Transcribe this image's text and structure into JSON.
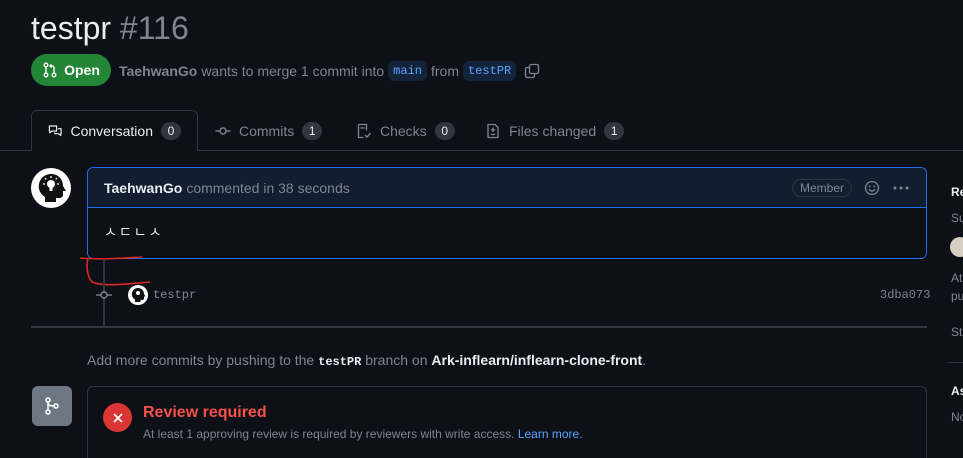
{
  "pr": {
    "title": "testpr",
    "number": "#116",
    "state": "Open",
    "author": "TaehwanGo",
    "merge_text": "wants to merge 1 commit into",
    "base_branch": "main",
    "from_text": "from",
    "head_branch": "testPR"
  },
  "tabs": [
    {
      "label": "Conversation",
      "count": "0",
      "icon": "comment-discussion-icon"
    },
    {
      "label": "Commits",
      "count": "1",
      "icon": "git-commit-icon"
    },
    {
      "label": "Checks",
      "count": "0",
      "icon": "checklist-icon"
    },
    {
      "label": "Files changed",
      "count": "1",
      "icon": "file-diff-icon"
    }
  ],
  "comment": {
    "author": "TaehwanGo",
    "meta": "commented in 38 seconds",
    "badge": "Member",
    "body": "ㅅㄷㄴㅅ"
  },
  "commit": {
    "message": "testpr",
    "sha": "3dba073"
  },
  "more_commits": {
    "prefix": "Add more commits by pushing to the",
    "branch": "testPR",
    "middle": "branch on",
    "repo": "Ark-inflearn/inflearn-clone-front",
    "suffix": "."
  },
  "review": {
    "title": "Review required",
    "description": "At least 1 approving review is required by reviewers with write access.",
    "link": "Learn more."
  },
  "sidebar": {
    "reviewers_head": "Re",
    "reviewers_sub": "Su",
    "at_line1": "At",
    "at_line2": "pu",
    "still": "Sti",
    "assignees_head": "As",
    "assignees_sub": "No"
  },
  "colors": {
    "open_green": "#238636",
    "accent_blue": "#1f6feb",
    "link_blue": "#58a6ff",
    "danger_red": "#da3633",
    "background": "#0d1117"
  }
}
